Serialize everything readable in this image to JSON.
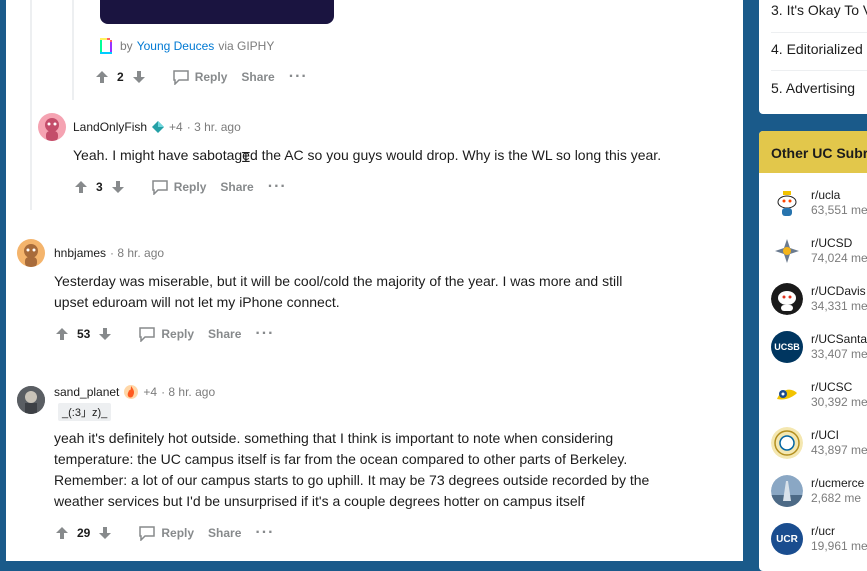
{
  "giphy": {
    "prefix": "by",
    "author": "Young Deuces",
    "suffix": "via GIPHY"
  },
  "gif_comment_actions": {
    "score": "2",
    "reply": "Reply",
    "share": "Share",
    "more": "···"
  },
  "comments": [
    {
      "user": "LandOnlyFish",
      "karma": "+4",
      "time": "· 3 hr. ago",
      "body": "Yeah. I might have sabotaged the AC so you guys would drop. Why is the WL so long this year.",
      "score": "3",
      "reply": "Reply",
      "share": "Share",
      "more": "···"
    },
    {
      "user": "hnbjames",
      "time": "· 8 hr. ago",
      "body1": "Yesterday was miserable, but it will be cool/cold the majority of the year. I was more and still",
      "body2": "upset eduroam will not let my iPhone connect.",
      "score": "53",
      "reply": "Reply",
      "share": "Share",
      "more": "···"
    },
    {
      "user": "sand_planet",
      "karma": "+4",
      "time": "· 8 hr. ago",
      "flair": "_(:3」z)_",
      "lines": [
        "yeah it's definitely hot outside. something that I think is important to note when considering",
        "temperature: the UC campus itself is far from the ocean compared to other parts of Berkeley.",
        "Remember: a lot of our campus starts to go uphill. It may be 73 degrees outside recorded by the",
        "weather services but I'd be unsurprised if it's a couple degrees hotter on campus itself"
      ],
      "score": "29",
      "reply": "Reply",
      "share": "Share",
      "more": "···"
    }
  ],
  "sidebar": {
    "rules": [
      "3. It's Okay To V",
      "4. Editorialized",
      "5. Advertising"
    ],
    "other_title": "Other UC Subr",
    "subs": [
      {
        "name": "r/ucla",
        "members": "63,551 me",
        "color": "#ffffff"
      },
      {
        "name": "r/UCSD",
        "members": "74,024 me",
        "color": "#ffffff"
      },
      {
        "name": "r/UCDavis",
        "members": "34,331 me",
        "color": "#1a1a1a"
      },
      {
        "name": "r/UCSanta",
        "members": "33,407 me",
        "color": "#003660",
        "icon_text": "UCSB"
      },
      {
        "name": "r/UCSC",
        "members": "30,392 me",
        "color": "#ffffff"
      },
      {
        "name": "r/UCI",
        "members": "43,897 me",
        "color": "#f4e7b0"
      },
      {
        "name": "r/ucmerce",
        "members": "2,682 me",
        "color": "#8aa7c4"
      },
      {
        "name": "r/ucr",
        "members": "19,961 me",
        "color": "#1a4d8f",
        "icon_text": "UCR"
      }
    ]
  },
  "colors": {
    "accent": "#0079d3",
    "gold": "#e2c74b",
    "page_bg": "#1a5a8a"
  }
}
